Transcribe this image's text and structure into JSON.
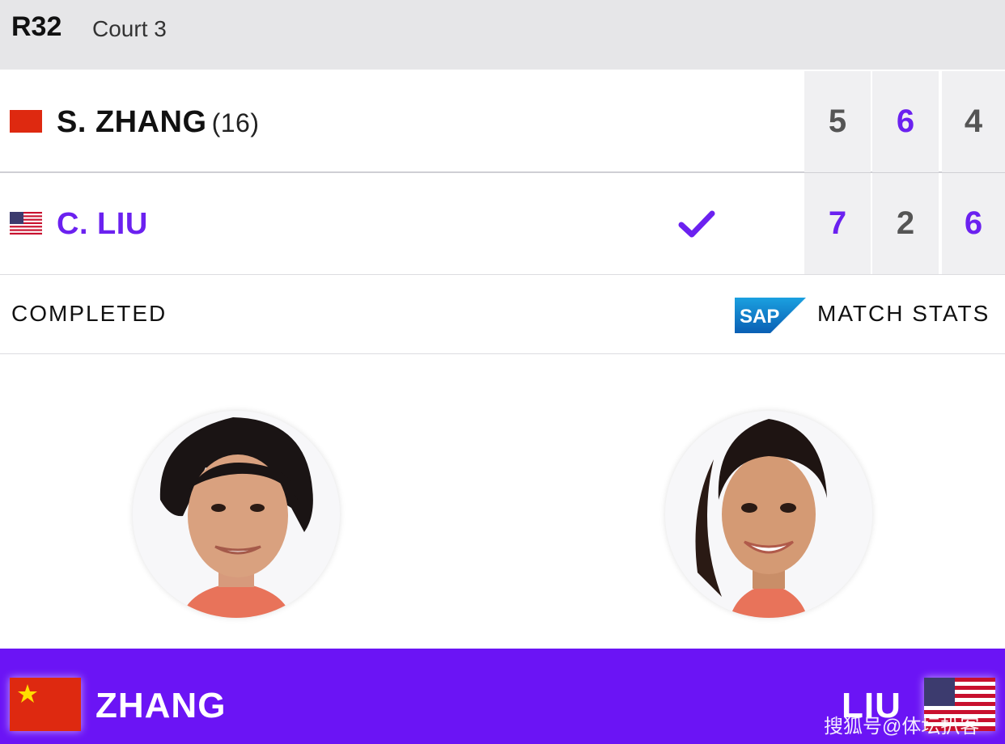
{
  "header": {
    "round": "R32",
    "court": "Court 3"
  },
  "players": [
    {
      "name": "S. ZHANG",
      "seed": "(16)",
      "flag": "china-flag-icon",
      "scores": [
        "5",
        "6",
        "4"
      ],
      "set_winner": [
        false,
        true,
        false
      ],
      "winner": false
    },
    {
      "name": "C. LIU",
      "seed": "",
      "flag": "usa-flag-icon",
      "scores": [
        "7",
        "2",
        "6"
      ],
      "set_winner": [
        true,
        false,
        true
      ],
      "winner": true
    }
  ],
  "status": {
    "label": "COMPLETED",
    "sponsor_logo_text": "SAP",
    "stats_link": "MATCH STATS"
  },
  "footer": {
    "left_name": "ZHANG",
    "right_name": "LIU"
  },
  "watermark": "搜狐号@体坛扒客",
  "colors": {
    "accent": "#6b21f0",
    "footer_bg": "#6b14f5",
    "header_bg": "#e6e6e8",
    "score_bg": "#f0f0f2"
  }
}
